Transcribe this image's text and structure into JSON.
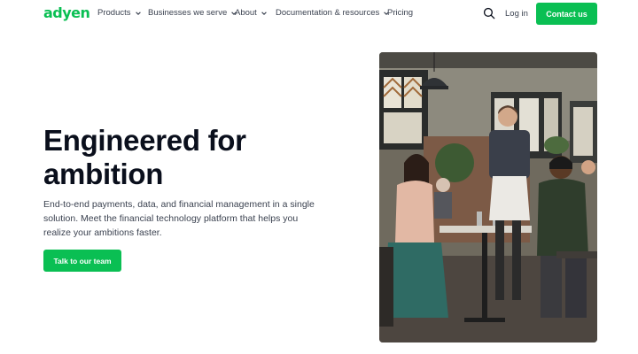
{
  "brand": {
    "logo_text": "adyen",
    "accent_color": "#0abf53"
  },
  "nav": {
    "items": [
      {
        "label": "Products",
        "has_dropdown": true
      },
      {
        "label": "Businesses we serve",
        "has_dropdown": true
      },
      {
        "label": "About",
        "has_dropdown": true
      },
      {
        "label": "Documentation & resources",
        "has_dropdown": true
      },
      {
        "label": "Pricing",
        "has_dropdown": false
      }
    ],
    "search_icon": "search-icon",
    "login_label": "Log in",
    "contact_label": "Contact us"
  },
  "hero": {
    "title": "Engineered for ambition",
    "description": "End-to-end payments, data, and financial management in a single solution. Meet the financial technology platform that helps you realize your ambitions faster.",
    "cta_label": "Talk to our team",
    "image_subject": "restaurant-scene-photo"
  }
}
